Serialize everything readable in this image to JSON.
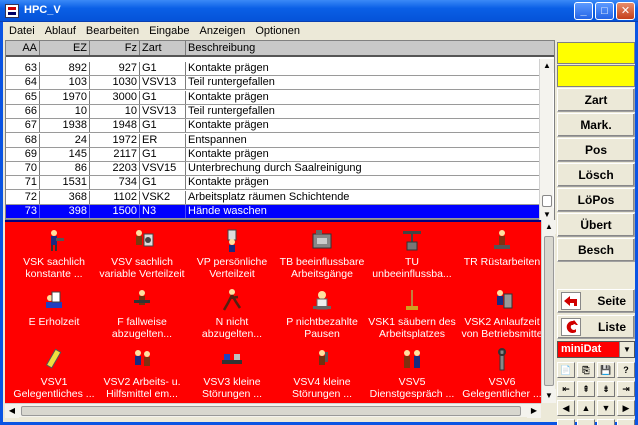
{
  "window": {
    "title": "HPC_V",
    "min": "_",
    "max": "□",
    "close": "✕"
  },
  "menu": [
    "Datei",
    "Ablauf",
    "Bearbeiten",
    "Eingabe",
    "Anzeigen",
    "Optionen"
  ],
  "grid": {
    "headers": {
      "aa": "AA",
      "ez": "EZ",
      "fz": "Fz",
      "zart": "Zart",
      "beschr": "Beschreibung"
    },
    "rows": [
      {
        "aa": "63",
        "ez": "892",
        "fz": "927",
        "zart": "G1",
        "beschr": "Kontakte prägen"
      },
      {
        "aa": "64",
        "ez": "103",
        "fz": "1030",
        "zart": "VSV13",
        "beschr": "Teil runtergefallen"
      },
      {
        "aa": "65",
        "ez": "1970",
        "fz": "3000",
        "zart": "G1",
        "beschr": "Kontakte prägen"
      },
      {
        "aa": "66",
        "ez": "10",
        "fz": "10",
        "zart": "VSV13",
        "beschr": "Teil runtergefallen"
      },
      {
        "aa": "67",
        "ez": "1938",
        "fz": "1948",
        "zart": "G1",
        "beschr": "Kontakte prägen"
      },
      {
        "aa": "68",
        "ez": "24",
        "fz": "1972",
        "zart": "ER",
        "beschr": "Entspannen"
      },
      {
        "aa": "69",
        "ez": "145",
        "fz": "2117",
        "zart": "G1",
        "beschr": "Kontakte prägen"
      },
      {
        "aa": "70",
        "ez": "86",
        "fz": "2203",
        "zart": "VSV15",
        "beschr": "Unterbrechung durch Saalreinigung"
      },
      {
        "aa": "71",
        "ez": "1531",
        "fz": "734",
        "zart": "G1",
        "beschr": "Kontakte prägen"
      },
      {
        "aa": "72",
        "ez": "368",
        "fz": "1102",
        "zart": "VSK2",
        "beschr": "Arbeitsplatz räumen Schichtende"
      },
      {
        "aa": "73",
        "ez": "398",
        "fz": "1500",
        "zart": "N3",
        "beschr": "Hände waschen"
      }
    ]
  },
  "tiles": [
    {
      "l1": "VSK sachlich",
      "l2": "konstante ...",
      "icon": "worker-tool-icon"
    },
    {
      "l1": "VSV sachlich",
      "l2": "variable Verteilzeit",
      "icon": "worker-machine-icon"
    },
    {
      "l1": "VP persönliche",
      "l2": "Verteilzeit",
      "icon": "person-drink-icon"
    },
    {
      "l1": "TB beeinflussbare",
      "l2": "Arbeitsgänge",
      "icon": "machine-icon"
    },
    {
      "l1": "TU",
      "l2": "unbeeinflussba...",
      "icon": "crane-icon"
    },
    {
      "l1": "TR Rüstarbeiten",
      "l2": "",
      "icon": "setup-worker-icon"
    },
    {
      "l1": "E Erholzeit",
      "l2": "",
      "icon": "rest-icon"
    },
    {
      "l1": "F fallweise",
      "l2": "abzugelten...",
      "icon": "lifting-icon"
    },
    {
      "l1": "N nicht",
      "l2": "abzugelten...",
      "icon": "running-icon"
    },
    {
      "l1": "P nichtbezahlte",
      "l2": "Pausen",
      "icon": "break-icon"
    },
    {
      "l1": "VSK1 säubern des",
      "l2": "Arbeitsplatzes",
      "icon": "broom-icon"
    },
    {
      "l1": "VSK2 Anlaufzeit",
      "l2": "von Betriebsmitte",
      "icon": "startup-icon"
    },
    {
      "l1": "VSV1",
      "l2": "Gelegentliches ...",
      "icon": "pencil-icon"
    },
    {
      "l1": "VSV2 Arbeits- u.",
      "l2": "Hilfsmittel em...",
      "icon": "handing-tools-icon"
    },
    {
      "l1": "VSV3 kleine",
      "l2": "Störungen ...",
      "icon": "conveyor-icon"
    },
    {
      "l1": "VSV4 kleine",
      "l2": "Störungen ...",
      "icon": "hammer-worker-icon"
    },
    {
      "l1": "VSV5",
      "l2": "Dienstgespräch ...",
      "icon": "talking-people-icon"
    },
    {
      "l1": "VSV6",
      "l2": "Gelegentlicher ...",
      "icon": "wrench-icon"
    }
  ],
  "right": {
    "buttons": [
      "Zart",
      "Mark.",
      "Pos",
      "Lösch",
      "LöPos",
      "Übert",
      "Besch"
    ],
    "seite": "Seite",
    "liste": "Liste",
    "combo": "miniDat",
    "tools1": [
      "📄",
      "⎘",
      "💾",
      "?"
    ],
    "nav_rows": [
      [
        "⇤",
        "⇞",
        "⇟",
        "⇥"
      ],
      [
        "◀",
        "▲",
        "▼",
        "▶"
      ],
      [
        "⇠",
        "↑",
        "↓",
        "⇢"
      ]
    ]
  },
  "colors": {
    "accent": "#0000ff",
    "panel": "#ff0000",
    "highlight": "#ffff00"
  }
}
